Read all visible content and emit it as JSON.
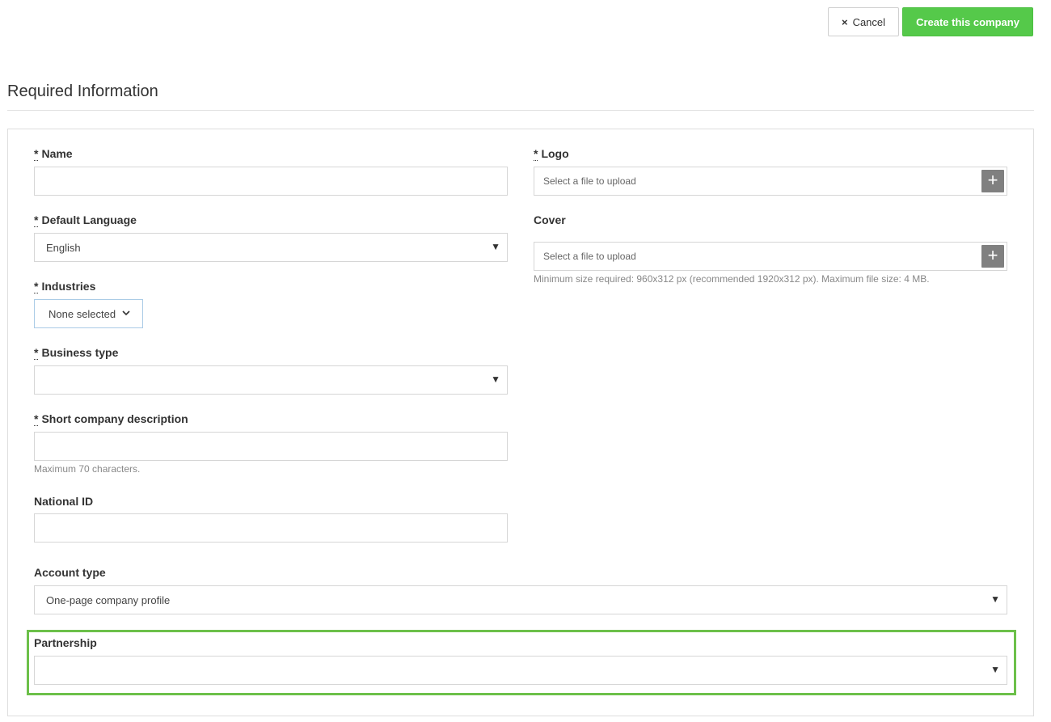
{
  "toolbar": {
    "cancel_icon": "×",
    "cancel_label": "Cancel",
    "create_label": "Create this company"
  },
  "section": {
    "title": "Required Information"
  },
  "form": {
    "required_marker": "*",
    "name": {
      "label": "Name",
      "value": ""
    },
    "default_language": {
      "label": "Default Language",
      "value": "English"
    },
    "industries": {
      "label": "Industries",
      "value": "None selected"
    },
    "business_type": {
      "label": "Business type",
      "value": ""
    },
    "short_description": {
      "label": "Short company description",
      "value": "",
      "hint": "Maximum 70 characters."
    },
    "national_id": {
      "label": "National ID",
      "value": ""
    },
    "account_type": {
      "label": "Account type",
      "value": "One-page company profile"
    },
    "partnership": {
      "label": "Partnership",
      "value": ""
    },
    "logo": {
      "label": "Logo",
      "placeholder": "Select a file to upload"
    },
    "cover": {
      "label": "Cover",
      "placeholder": "Select a file to upload",
      "hint": "Minimum size required: 960x312 px (recommended 1920x312 px). Maximum file size: 4 MB."
    }
  },
  "icons": {
    "select_arrow": "▼",
    "chevron": "⌄",
    "plus": "+"
  },
  "colors": {
    "primary_button": "#55c94a",
    "highlight_border": "#6cc04a",
    "upload_button": "#808080"
  }
}
